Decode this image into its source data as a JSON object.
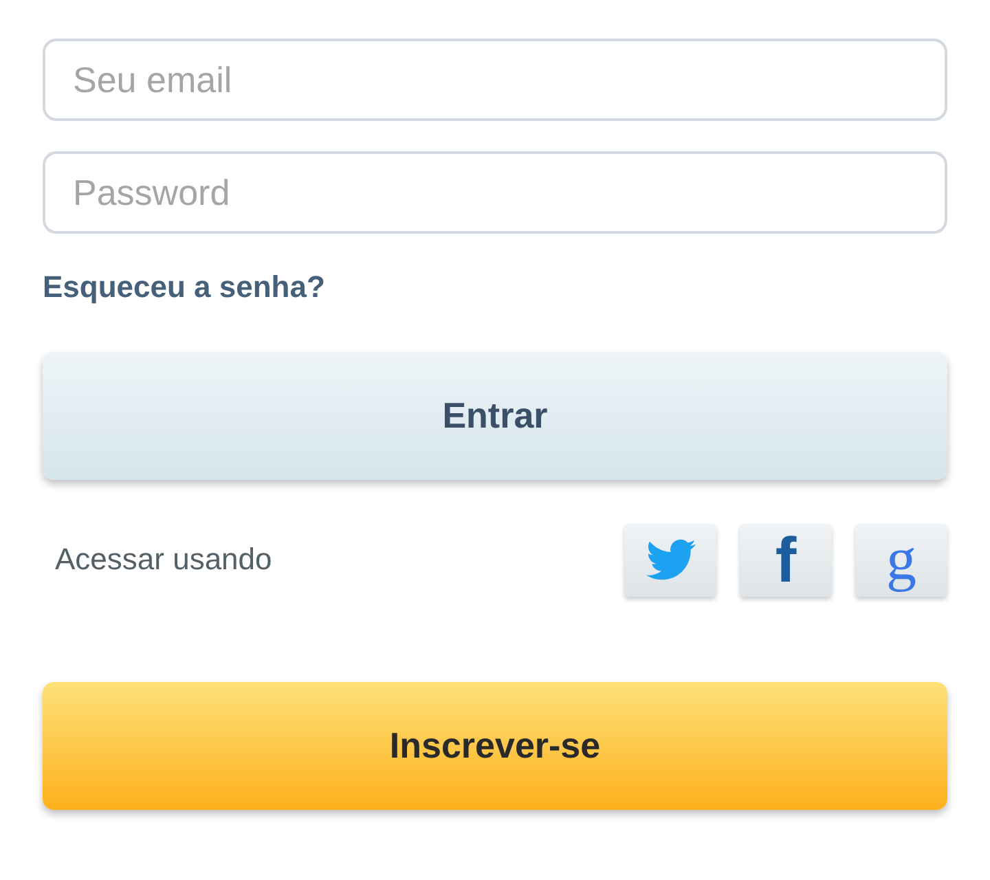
{
  "fields": [
    {
      "placeholder": "Seu email"
    },
    {
      "placeholder": "Password"
    }
  ],
  "forgot_link": "Esqueceu a senha?",
  "login_button": "Entrar",
  "social": {
    "label": "Acessar usando",
    "buttons": [
      {
        "kind": "twitter"
      },
      {
        "kind": "facebook",
        "label": "f"
      },
      {
        "kind": "google",
        "label": "g"
      }
    ]
  },
  "signup_button": "Inscrever-se"
}
